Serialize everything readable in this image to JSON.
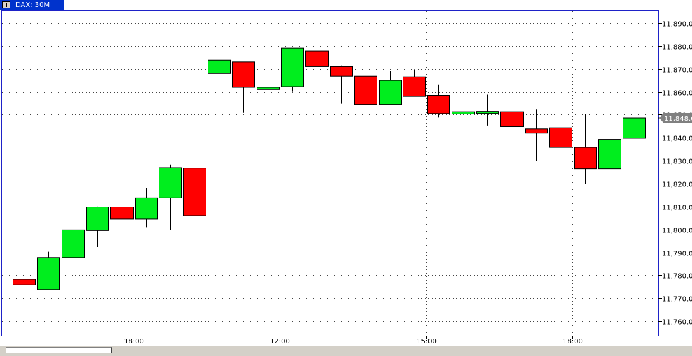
{
  "tab": {
    "label": "DAX: 30M",
    "icon": "chart-window-icon"
  },
  "colors": {
    "up": "#00ee1e",
    "down": "#ff0000",
    "frame": "#1e22c8",
    "tab": "#0033cc",
    "grid": "#444444",
    "price_tag": "#808080"
  },
  "chart_data": {
    "type": "candlestick",
    "title": "",
    "xlabel": "",
    "ylabel": "",
    "ylim": [
      11752,
      11896
    ],
    "y_ticks": [
      11760,
      11770,
      11780,
      11790,
      11800,
      11810,
      11820,
      11830,
      11840,
      11850,
      11860,
      11870,
      11880,
      11890
    ],
    "y_tick_labels": [
      "11,760.0",
      "11,770.0",
      "11,780.0",
      "11,790.0",
      "11,800.0",
      "11,810.0",
      "11,820.0",
      "11,830.0",
      "11,840.0",
      "11,850.0",
      "11,860.0",
      "11,870.0",
      "11,880.0",
      "11,890.0"
    ],
    "x_ticks": [
      {
        "label": "18:00",
        "index": 4.5
      },
      {
        "label": "12:00",
        "index": 10.5
      },
      {
        "label": "15:00",
        "index": 16.5
      },
      {
        "label": "18:00",
        "index": 22.5
      }
    ],
    "grid": true,
    "last_price": "11,848.6",
    "last_value": 11848.6,
    "candles": [
      {
        "open": 11778.3,
        "high": 11779.5,
        "low": 11766.3,
        "close": 11775.8
      },
      {
        "open": 11773.8,
        "high": 11790.3,
        "low": 11773.8,
        "close": 11787.8
      },
      {
        "open": 11787.8,
        "high": 11804.5,
        "low": 11787.8,
        "close": 11799.8
      },
      {
        "open": 11799.5,
        "high": 11810.0,
        "low": 11792.3,
        "close": 11809.8
      },
      {
        "open": 11809.8,
        "high": 11820.3,
        "low": 11804.5,
        "close": 11804.5
      },
      {
        "open": 11804.5,
        "high": 11818.0,
        "low": 11801.0,
        "close": 11813.8
      },
      {
        "open": 11813.8,
        "high": 11828.3,
        "low": 11799.8,
        "close": 11827.0
      },
      {
        "open": 11826.8,
        "high": 11826.8,
        "low": 11806.0,
        "close": 11806.0
      },
      {
        "open": 11868.0,
        "high": 11893.0,
        "low": 11859.8,
        "close": 11873.8
      },
      {
        "open": 11873.0,
        "high": 11873.0,
        "low": 11850.8,
        "close": 11862.0
      },
      {
        "open": 11861.0,
        "high": 11872.0,
        "low": 11857.0,
        "close": 11862.0
      },
      {
        "open": 11862.3,
        "high": 11878.3,
        "low": 11860.0,
        "close": 11879.0
      },
      {
        "open": 11877.8,
        "high": 11880.5,
        "low": 11868.8,
        "close": 11871.0
      },
      {
        "open": 11871.0,
        "high": 11871.5,
        "low": 11854.8,
        "close": 11866.8
      },
      {
        "open": 11866.8,
        "high": 11866.8,
        "low": 11854.5,
        "close": 11854.5
      },
      {
        "open": 11854.5,
        "high": 11869.3,
        "low": 11854.5,
        "close": 11865.0
      },
      {
        "open": 11866.5,
        "high": 11869.8,
        "low": 11858.0,
        "close": 11858.0
      },
      {
        "open": 11858.5,
        "high": 11863.0,
        "low": 11848.8,
        "close": 11850.5
      },
      {
        "open": 11850.3,
        "high": 11852.3,
        "low": 11840.3,
        "close": 11851.3
      },
      {
        "open": 11851.0,
        "high": 11858.8,
        "low": 11845.3,
        "close": 11851.0
      },
      {
        "open": 11851.3,
        "high": 11855.5,
        "low": 11843.3,
        "close": 11844.8
      },
      {
        "open": 11843.8,
        "high": 11852.5,
        "low": 11829.8,
        "close": 11842.0
      },
      {
        "open": 11844.3,
        "high": 11852.5,
        "low": 11836.0,
        "close": 11835.8
      },
      {
        "open": 11835.8,
        "high": 11850.3,
        "low": 11820.0,
        "close": 11826.5
      },
      {
        "open": 11826.5,
        "high": 11843.8,
        "low": 11825.3,
        "close": 11839.3
      },
      {
        "open": 11839.8,
        "high": 11848.6,
        "low": 11839.8,
        "close": 11848.6
      }
    ]
  }
}
